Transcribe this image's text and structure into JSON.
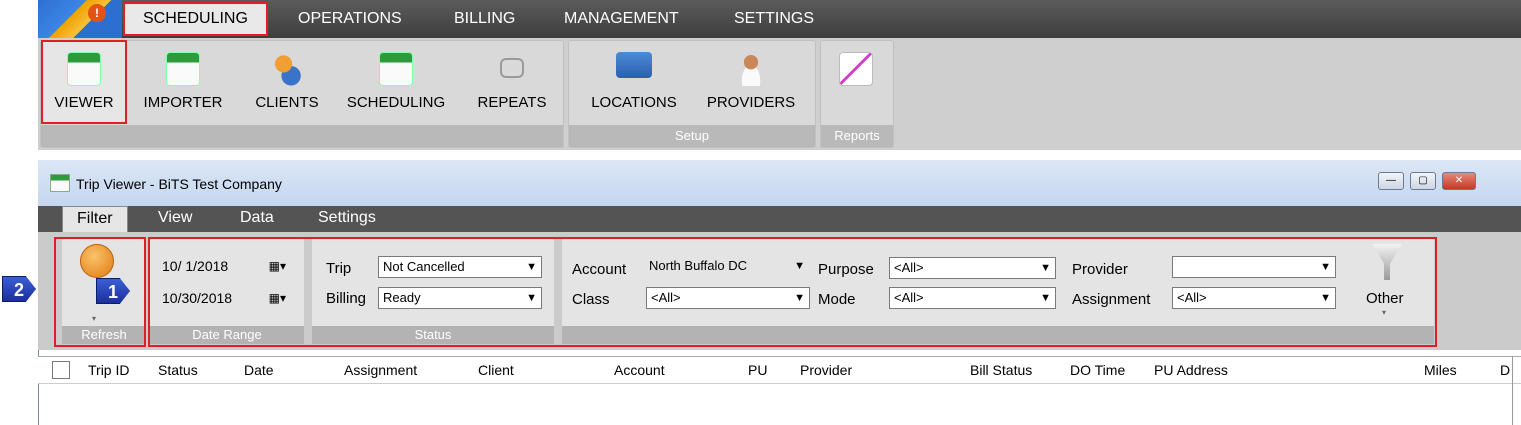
{
  "menu": {
    "items": [
      "SCHEDULING",
      "OPERATIONS",
      "BILLING",
      "MANAGEMENT",
      "SETTINGS"
    ],
    "alert": "!"
  },
  "ribbon": {
    "buttons": [
      "VIEWER",
      "IMPORTER",
      "CLIENTS",
      "SCHEDULING",
      "REPEATS",
      "LOCATIONS",
      "PROVIDERS"
    ],
    "setup_label": "Setup",
    "reports_label": "Reports"
  },
  "window": {
    "title": "Trip Viewer - BiTS Test Company",
    "min": "—",
    "max": "▢",
    "close": "✕"
  },
  "tabs": [
    "Filter",
    "View",
    "Data",
    "Settings"
  ],
  "filter": {
    "refresh_label": "Refresh",
    "date_range_label": "Date Range",
    "date_from": "10/ 1/2018",
    "date_to": "10/30/2018",
    "status_label": "Status",
    "trip_label": "Trip",
    "trip_value": "Not Cancelled",
    "billing_label": "Billing",
    "billing_value": "Ready",
    "account_label": "Account",
    "account_value": "North Buffalo DC",
    "class_label": "Class",
    "class_value": "<All>",
    "purpose_label": "Purpose",
    "purpose_value": "<All>",
    "mode_label": "Mode",
    "mode_value": "<All>",
    "provider_label": "Provider",
    "provider_value": "",
    "assignment_label": "Assignment",
    "assignment_value": "<All>",
    "other_label": "Other"
  },
  "callouts": [
    "1",
    "2"
  ],
  "grid": {
    "columns": [
      "Trip ID",
      "Status",
      "Date",
      "Assignment",
      "Client",
      "Account",
      "PU",
      "Provider",
      "Bill Status",
      "DO Time",
      "PU Address",
      "Miles",
      "D"
    ]
  }
}
